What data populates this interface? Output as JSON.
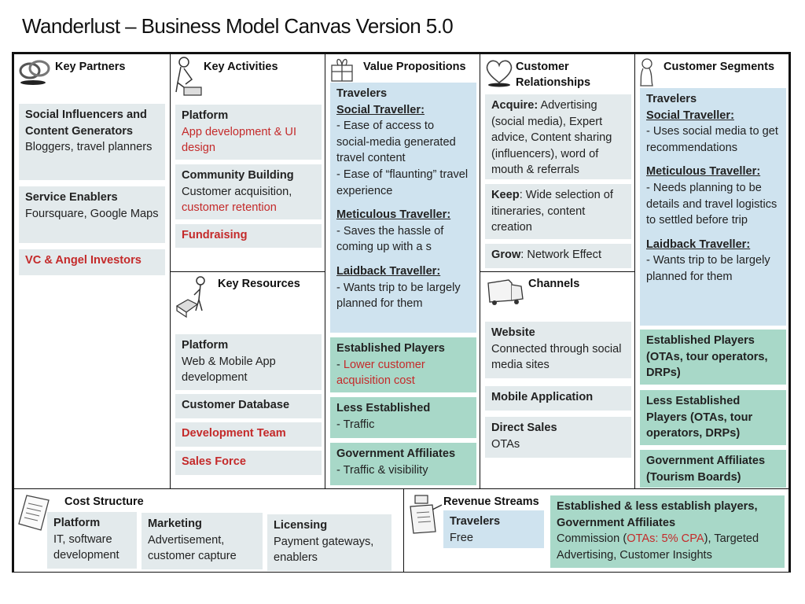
{
  "title": "Wanderlust –  Business Model Canvas Version 5.0",
  "key_partners": {
    "heading": "Key Partners",
    "icon": "chain-links-icon",
    "cards": [
      {
        "title": "Social Influencers and Content Generators",
        "text": "Bloggers, travel planners"
      },
      {
        "title": "Service Enablers",
        "text": "Foursquare, Google Maps"
      },
      {
        "title_red": "VC & Angel Investors"
      }
    ]
  },
  "key_activities": {
    "heading": "Key Activities",
    "icon": "worker-icon",
    "cards": [
      {
        "title": "Platform",
        "text_red": "App development & UI design"
      },
      {
        "title": "Community Building",
        "text": "Customer acquisition,",
        "text_red": "customer retention"
      },
      {
        "title_red": "Fundraising"
      }
    ]
  },
  "key_resources": {
    "heading": "Key Resources",
    "icon": "person-with-machine-icon",
    "cards": [
      {
        "title": "Platform",
        "text": "Web & Mobile App development"
      },
      {
        "title": "Customer Database"
      },
      {
        "title_red": "Development Team"
      },
      {
        "title_red": "Sales Force"
      }
    ]
  },
  "value_propositions": {
    "heading": "Value Propositions",
    "icon": "gift-icon",
    "travelers": {
      "title": "Travelers",
      "social_label": "Social Traveller:",
      "social_lines": [
        "- Ease of access to social-media generated travel content",
        "- Ease of “flaunting” travel experience"
      ],
      "meticulous_label": "Meticulous Traveller:",
      "meticulous_lines": [
        "- Saves the hassle of coming up with a s"
      ],
      "laidback_label": "Laidback Traveller:",
      "laidback_lines": [
        "- Wants trip to be largely planned for them"
      ]
    },
    "cards": [
      {
        "title": "Established Players",
        "prefix": "- ",
        "text_red": "Lower customer acquisition cost"
      },
      {
        "title": "Less Established",
        "text": "- Traffic"
      },
      {
        "title": "Government Affiliates",
        "text": "- Traffic & visibility"
      }
    ]
  },
  "customer_relationships": {
    "heading_line1": "Customer",
    "heading_line2": "Relationships",
    "icon": "heart-icon",
    "cards": [
      {
        "label": "Acquire:",
        "text": " Advertising (social media), Expert advice, Content sharing (influencers), word of mouth & referrals"
      },
      {
        "label": "Keep",
        "text": ": Wide selection of itineraries, content creation"
      },
      {
        "label": "Grow",
        "text": ": Network Effect"
      }
    ]
  },
  "channels": {
    "heading": "Channels",
    "icon": "truck-icon",
    "cards": [
      {
        "title": "Website",
        "text": "Connected through social media sites"
      },
      {
        "title": "Mobile Application"
      },
      {
        "title": "Direct Sales",
        "text": "OTAs"
      }
    ]
  },
  "customer_segments": {
    "heading": "Customer Segments",
    "icon": "person-icon",
    "travelers": {
      "title": "Travelers",
      "social_label": "Social Traveller:",
      "social_lines": [
        "- Uses social media to get recommendations"
      ],
      "meticulous_label": "Meticulous Traveller:",
      "meticulous_lines": [
        "- Needs planning to be details and travel logistics to settled before trip"
      ],
      "laidback_label": "Laidback Traveller:",
      "laidback_lines": [
        "- Wants trip to be largely planned for them"
      ]
    },
    "cards": [
      {
        "title": "Established Players (OTAs, tour operators, DRPs)"
      },
      {
        "title": "Less Established Players (OTAs, tour operators, DRPs)"
      },
      {
        "title": "Government Affiliates (Tourism Boards)"
      }
    ]
  },
  "cost_structure": {
    "heading": "Cost Structure",
    "icon": "receipt-icon",
    "cards": [
      {
        "title": "Platform",
        "text": "IT, software development"
      },
      {
        "title": "Marketing",
        "text": "Advertisement, customer capture"
      },
      {
        "title": "Licensing",
        "text": "Payment gateways, enablers"
      }
    ]
  },
  "revenue_streams": {
    "heading": "Revenue Streams",
    "icon": "cash-register-icon",
    "travelers": {
      "title": "Travelers",
      "text": "Free"
    },
    "players": {
      "title": "Established & less establish players, Government Affiliates",
      "text_before": "Commission (",
      "text_red": "OTAs: 5% CPA",
      "text_after": "), Targeted Advertising, Customer Insights"
    }
  },
  "colors": {
    "card_gray": "#e3eaec",
    "card_blue": "#cfe3ef",
    "card_green": "#a8d8c8",
    "accent_red": "#c42a2a",
    "border": "#111111"
  }
}
